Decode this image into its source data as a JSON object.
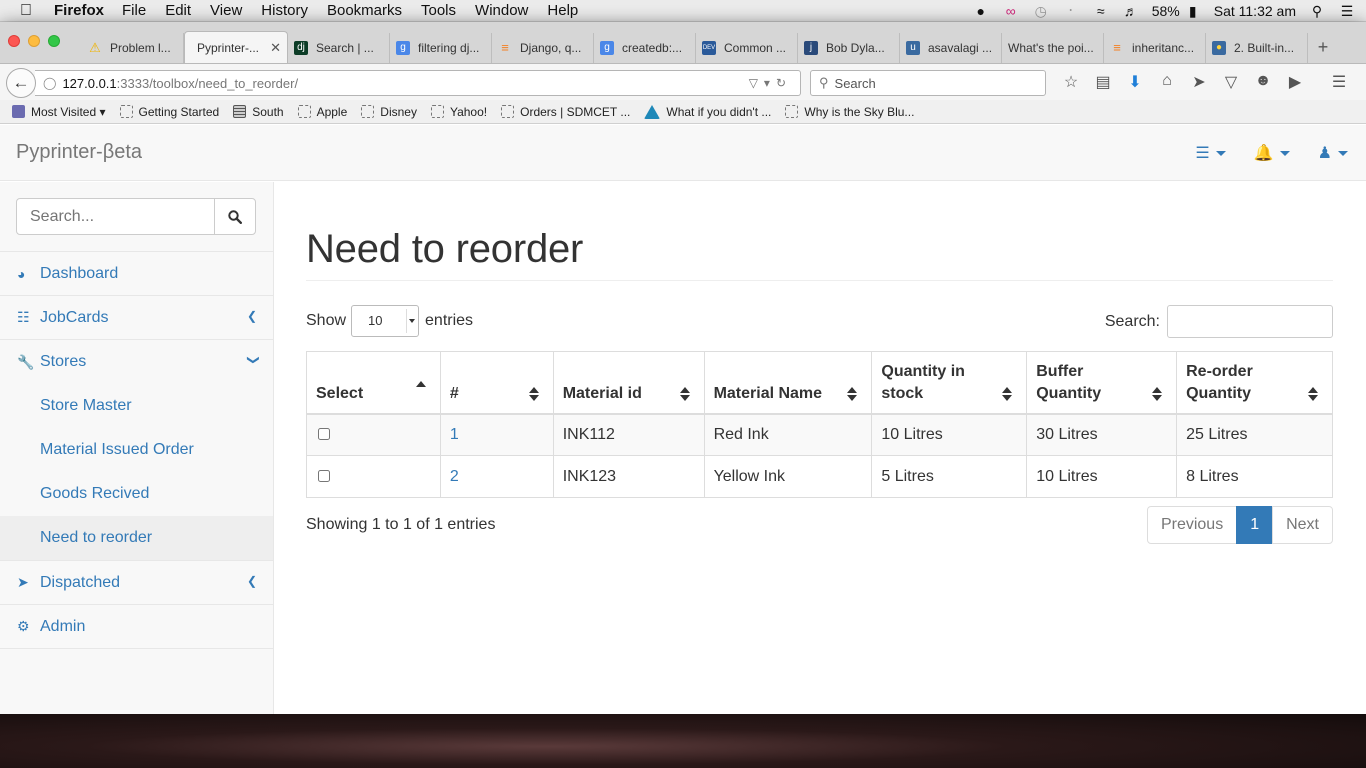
{
  "menubar": {
    "app": "Firefox",
    "items": [
      "File",
      "Edit",
      "View",
      "History",
      "Bookmarks",
      "Tools",
      "Window",
      "Help"
    ],
    "battery": "58%",
    "clock": "Sat 11:32 am"
  },
  "tabs": [
    {
      "label": "Problem l...",
      "icon": "warning-icon",
      "color": "#f0b400"
    },
    {
      "label": "Pyprinter-...",
      "icon": "page-icon",
      "color": "#ffffff"
    },
    {
      "label": "Search | ...",
      "icon": "django-icon",
      "color": "#0c3c26"
    },
    {
      "label": "filtering dj...",
      "icon": "google-icon",
      "color": "#4a87e8"
    },
    {
      "label": "Django, q...",
      "icon": "stackoverflow-icon",
      "color": "#f48024"
    },
    {
      "label": "createdb:...",
      "icon": "google-icon",
      "color": "#4a87e8"
    },
    {
      "label": "Common ...",
      "icon": "devsys-icon",
      "color": "#2a5a9a"
    },
    {
      "label": "Bob Dyla...",
      "icon": "bookmark-icon",
      "color": "#2a4a7a"
    },
    {
      "label": "asavalagi ...",
      "icon": "cup-icon",
      "color": "#3a6aa0"
    },
    {
      "label": "What's the poi...",
      "icon": "blank-icon",
      "color": "#d6d6d6"
    },
    {
      "label": "inheritanc...",
      "icon": "stackoverflow-icon",
      "color": "#f48024"
    },
    {
      "label": "2. Built-in...",
      "icon": "python-icon",
      "color": "#3a6aa0"
    }
  ],
  "url": {
    "host": "127.0.0.1",
    "path": ":3333/toolbox/need_to_reorder/"
  },
  "browser_search_placeholder": "Search",
  "bookmarks": [
    {
      "label": "Most Visited",
      "type": "solid"
    },
    {
      "label": "Getting Started",
      "type": "dashed"
    },
    {
      "label": "South",
      "type": "grid"
    },
    {
      "label": "Apple",
      "type": "dashed"
    },
    {
      "label": "Disney",
      "type": "dashed"
    },
    {
      "label": "Yahoo!",
      "type": "dashed"
    },
    {
      "label": "Orders | SDMCET ...",
      "type": "dashed"
    },
    {
      "label": "What if you didn't ...",
      "type": "tri"
    },
    {
      "label": "Why is the Sky Blu...",
      "type": "dashed"
    }
  ],
  "app": {
    "brand": "Pyprinter-βeta",
    "sidebar": {
      "search_placeholder": "Search...",
      "dashboard": "Dashboard",
      "jobcards": "JobCards",
      "stores": "Stores",
      "store_master": "Store Master",
      "material_issued": "Material Issued Order",
      "goods_received": "Goods Recived",
      "need_reorder": "Need to reorder",
      "dispatched": "Dispatched",
      "admin": "Admin"
    },
    "page_title": "Need to reorder",
    "show_label": "Show",
    "entries_label": "entries",
    "page_length": "10",
    "search_label": "Search:",
    "columns": [
      "Select",
      "#",
      "Material id",
      "Material Name",
      "Quantity in stock",
      "Buffer Quantity",
      "Re-order Quantity"
    ],
    "rows": [
      {
        "num": "1",
        "material_id": "INK112",
        "name": "Red Ink",
        "stock": "10 Litres",
        "buffer": "30 Litres",
        "reorder": "25 Litres"
      },
      {
        "num": "2",
        "material_id": "INK123",
        "name": "Yellow Ink",
        "stock": "5 Litres",
        "buffer": "10 Litres",
        "reorder": "8 Litres"
      }
    ],
    "info": "Showing 1 to 1 of 1 entries",
    "pager": {
      "previous": "Previous",
      "current": "1",
      "next": "Next"
    }
  },
  "colors": {
    "link": "#337ab7",
    "pager_active": "#337ab7"
  }
}
